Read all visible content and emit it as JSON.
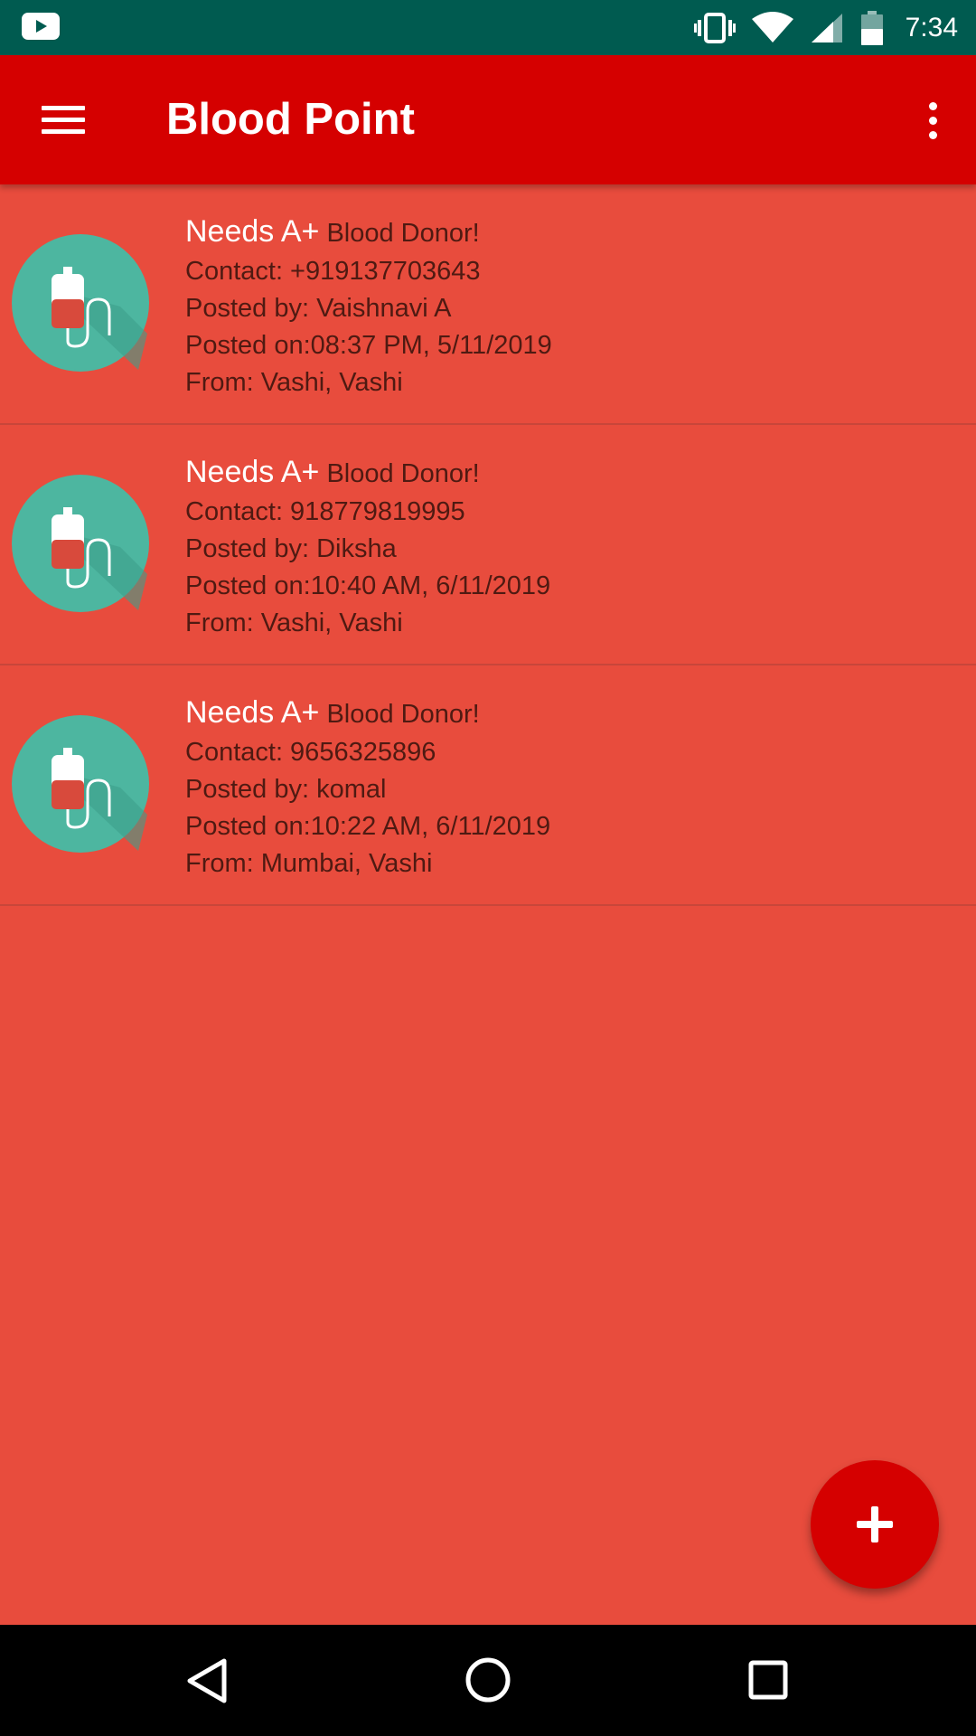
{
  "status_bar": {
    "time": "7:34",
    "icons": [
      "youtube-icon",
      "vibrate-icon",
      "wifi-icon",
      "cell-signal-icon",
      "battery-icon"
    ]
  },
  "app_bar": {
    "title": "Blood Point",
    "left_icon": "menu-icon",
    "right_icon": "more-vert-icon"
  },
  "posts": [
    {
      "needs": "Needs A+",
      "donor": " Blood Donor!",
      "contact": "Contact: +919137703643",
      "posted_by": "Posted by: Vaishnavi A",
      "posted_on": "Posted on:08:37 PM, 5/11/2019",
      "from": "From: Vashi, Vashi"
    },
    {
      "needs": "Needs A+",
      "donor": " Blood Donor!",
      "contact": "Contact: 918779819995",
      "posted_by": "Posted by: Diksha",
      "posted_on": "Posted on:10:40 AM, 6/11/2019",
      "from": "From: Vashi, Vashi"
    },
    {
      "needs": "Needs A+",
      "donor": " Blood Donor!",
      "contact": "Contact: 9656325896",
      "posted_by": "Posted by: komal",
      "posted_on": "Posted on:10:22 AM, 6/11/2019",
      "from": "From: Mumbai, Vashi"
    }
  ],
  "fab": {
    "icon": "plus-icon"
  },
  "nav_bar": {
    "icons": [
      "back-icon",
      "home-icon",
      "recents-icon"
    ]
  },
  "colors": {
    "status_bar": "#005B50",
    "app_bar": "#D50000",
    "background": "#E84C3D",
    "avatar": "#4DB6A0",
    "fab": "#D50000"
  }
}
